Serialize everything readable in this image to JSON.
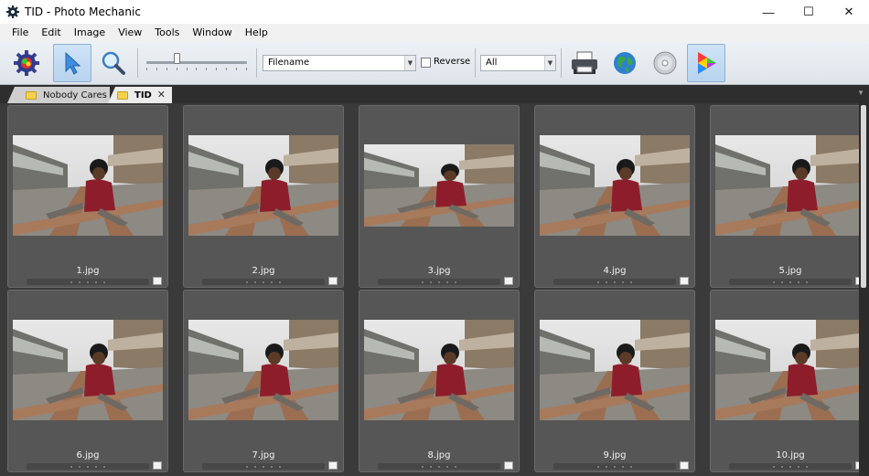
{
  "window": {
    "title": "TID - Photo Mechanic",
    "minimize_icon": "minimize-icon",
    "maximize_icon": "maximize-icon",
    "close_icon": "close-icon"
  },
  "menu": [
    "File",
    "Edit",
    "Image",
    "View",
    "Tools",
    "Window",
    "Help"
  ],
  "toolbar": {
    "sort_field": "Filename",
    "reverse_label": "Reverse",
    "reverse_checked": false,
    "filter_value": "All",
    "icons": [
      "preferences-gear-icon",
      "select-arrow-icon",
      "zoom-magnifier-icon",
      "print-icon",
      "web-globe-icon",
      "burn-disc-icon",
      "color-class-icon"
    ]
  },
  "tabs": [
    {
      "label": "Nobody Cares",
      "active": false
    },
    {
      "label": "TID",
      "active": true
    }
  ],
  "photos": [
    {
      "filename": "1.jpg"
    },
    {
      "filename": "2.jpg"
    },
    {
      "filename": "3.jpg"
    },
    {
      "filename": "4.jpg"
    },
    {
      "filename": "5.jpg"
    },
    {
      "filename": "6.jpg"
    },
    {
      "filename": "7.jpg"
    },
    {
      "filename": "8.jpg"
    },
    {
      "filename": "9.jpg"
    },
    {
      "filename": "10.jpg"
    }
  ],
  "colors": {
    "grid_background": "#3a3a3a",
    "cell_background": "#565656",
    "toolbar": "#e4e8ee",
    "coat": "#8e1d2b"
  }
}
